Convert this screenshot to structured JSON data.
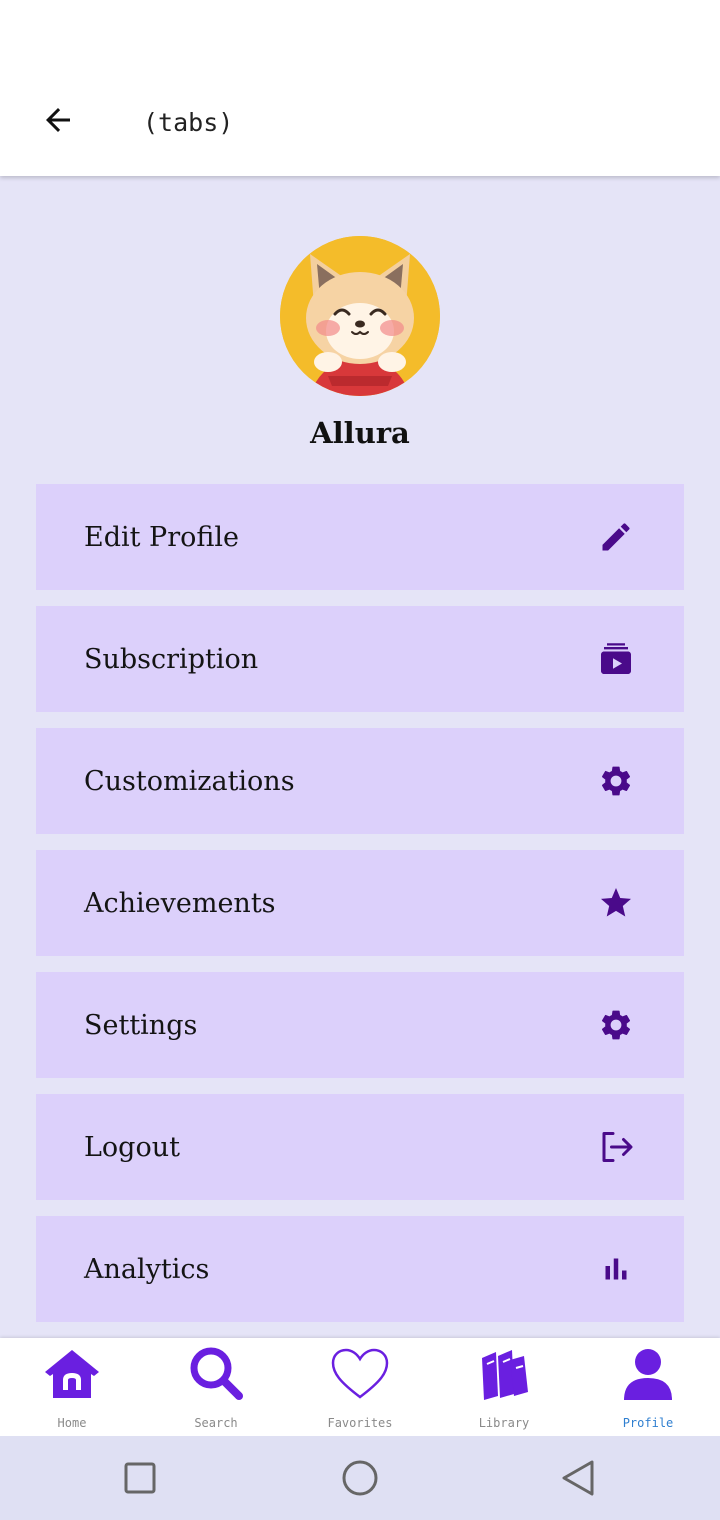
{
  "header": {
    "title": "(tabs)",
    "back_icon": "arrow-left-icon"
  },
  "profile": {
    "username": "Allura",
    "avatar_alt": "shiba-avatar"
  },
  "menu": [
    {
      "label": "Edit Profile",
      "icon": "pencil-icon"
    },
    {
      "label": "Subscription",
      "icon": "subscriptions-icon"
    },
    {
      "label": "Customizations",
      "icon": "gear-icon"
    },
    {
      "label": "Achievements",
      "icon": "star-icon"
    },
    {
      "label": "Settings",
      "icon": "gear-icon"
    },
    {
      "label": "Logout",
      "icon": "logout-icon"
    },
    {
      "label": "Analytics",
      "icon": "bar-chart-icon"
    }
  ],
  "bottom_nav": [
    {
      "label": "Home",
      "icon": "home-icon",
      "active": false
    },
    {
      "label": "Search",
      "icon": "search-icon",
      "active": false
    },
    {
      "label": "Favorites",
      "icon": "heart-icon",
      "active": false
    },
    {
      "label": "Library",
      "icon": "books-icon",
      "active": false
    },
    {
      "label": "Profile",
      "icon": "user-icon",
      "active": true
    }
  ],
  "colors": {
    "accent": "#6a1fe0",
    "menu_icon": "#4a0a8a",
    "menu_bg": "#dcd0fb",
    "page_bg": "#e5e4f7",
    "active_label": "#2f7fd0"
  }
}
